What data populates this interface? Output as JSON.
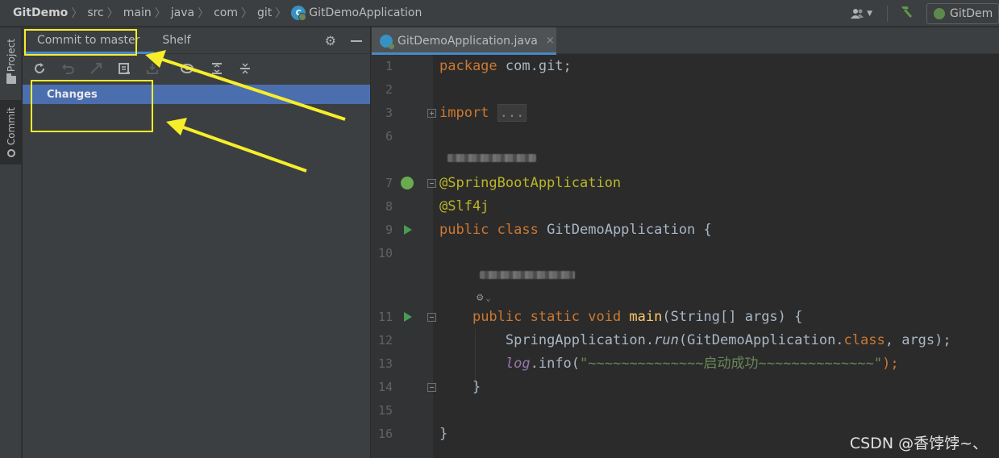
{
  "breadcrumb": [
    "GitDemo",
    "src",
    "main",
    "java",
    "com",
    "git",
    "GitDemoApplication"
  ],
  "topbar": {
    "run_config": "GitDem"
  },
  "stripe": {
    "project": "Project",
    "commit": "Commit"
  },
  "toolwindow": {
    "tabs": [
      {
        "label": "Commit to master",
        "active": true
      },
      {
        "label": "Shelf",
        "active": false
      }
    ],
    "toolbar_icons": [
      "refresh-icon",
      "rollback-icon",
      "diff-icon",
      "changelist-icon",
      "shelve-icon",
      "view-options-icon",
      "expand-all-icon",
      "collapse-all-icon"
    ],
    "changes_label": "Changes"
  },
  "editor": {
    "tab_label": "GitDemoApplication.java",
    "tab_close": "×",
    "code_lines": {
      "l1_kw": "package",
      "l1_rest": " com.git;",
      "l3_kw": "import",
      "l3_dots": "...",
      "l7": "@SpringBootApplication",
      "l8": "@Slf4j",
      "l9_kw": "public class ",
      "l9_rest": "GitDemoApplication {",
      "l11_kw": "public static void ",
      "l11_fn": "main",
      "l11_rest": "(String[] args) {",
      "l12_a": "SpringApplication.",
      "l12_run": "run",
      "l12_b": "(GitDemoApplication.",
      "l12_kw": "class",
      "l12_c": ", args);",
      "l13_log": "log",
      "l13_a": ".info(",
      "l13_str": "\"~~~~~~~~~~~~~~启动成功~~~~~~~~~~~~~~\"",
      "l13_b": ");",
      "l14": "}",
      "l16": "}"
    },
    "line_numbers": [
      "1",
      "2",
      "3",
      "6",
      "7",
      "8",
      "9",
      "10",
      "11",
      "12",
      "13",
      "14",
      "15",
      "16"
    ]
  },
  "watermark": "CSDN @香饽饽~、",
  "colors": {
    "annotation_yellow": "#f6ee2a",
    "selection_blue": "#4b6eaf",
    "keyword_orange": "#cc7832"
  }
}
